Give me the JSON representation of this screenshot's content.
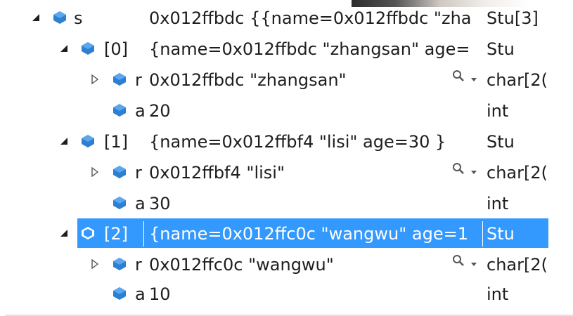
{
  "watch": {
    "rows": [
      {
        "name": "s",
        "value": "0x012ffbdc {{name=0x012ffbdc \"zha",
        "type": "Stu[3]"
      },
      {
        "name": "[0]",
        "value": "{name=0x012ffbdc \"zhangsan\" age=",
        "type": "Stu"
      },
      {
        "name": "r",
        "value": "0x012ffbdc \"zhangsan\"",
        "type": "char[2("
      },
      {
        "name": "a",
        "value": "20",
        "type": "int"
      },
      {
        "name": "[1]",
        "value": "{name=0x012ffbf4 \"lisi\" age=30 }",
        "type": "Stu"
      },
      {
        "name": "r",
        "value": "0x012ffbf4 \"lisi\"",
        "type": "char[2("
      },
      {
        "name": "a",
        "value": "30",
        "type": "int"
      },
      {
        "name": "[2]",
        "value": "{name=0x012ffc0c \"wangwu\" age=1",
        "type": "Stu"
      },
      {
        "name": "r",
        "value": "0x012ffc0c \"wangwu\"",
        "type": "char[2("
      },
      {
        "name": "a",
        "value": "10",
        "type": "int"
      }
    ]
  },
  "colors": {
    "selection": "#3399ff",
    "cube": "#2d7fd1",
    "text": "#1e1e1e"
  },
  "icons": {
    "expanded": "expanded-arrow-icon",
    "collapsed": "collapsed-arrow-icon",
    "member": "member-cube-icon",
    "visualizer": "magnifier-dropdown-icon"
  }
}
